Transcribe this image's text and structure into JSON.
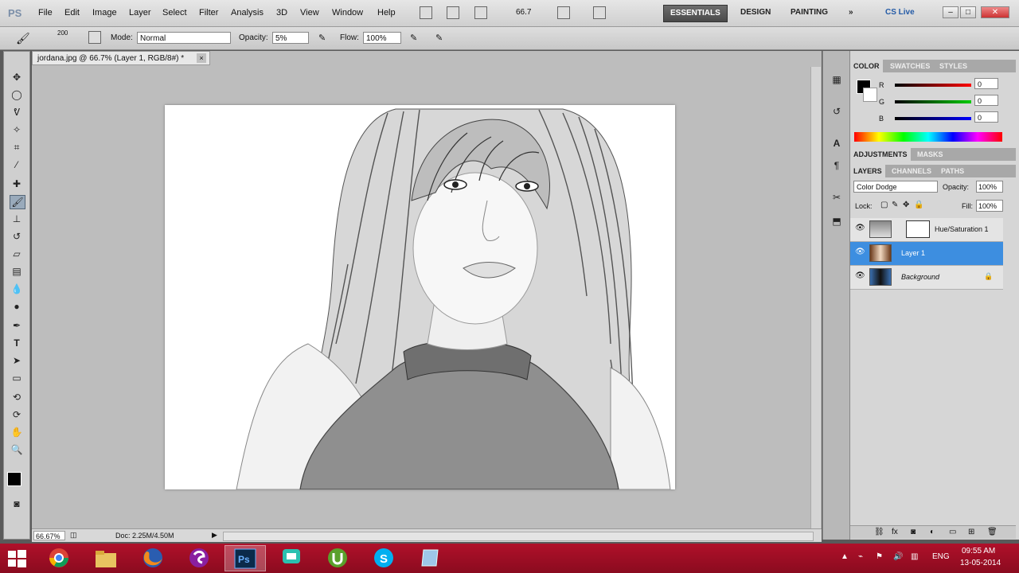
{
  "app": {
    "logo": "PS"
  },
  "menu": {
    "items": [
      "File",
      "Edit",
      "Image",
      "Layer",
      "Select",
      "Filter",
      "Analysis",
      "3D",
      "View",
      "Window",
      "Help"
    ]
  },
  "appbar": {
    "zoom": "66.7"
  },
  "workspaces": {
    "items": [
      "ESSENTIALS",
      "DESIGN",
      "PAINTING"
    ],
    "more": "»",
    "cslive": "CS Live"
  },
  "options": {
    "brush_size": "200",
    "mode_label": "Mode:",
    "mode_value": "Normal",
    "opacity_label": "Opacity:",
    "opacity_value": "5%",
    "flow_label": "Flow:",
    "flow_value": "100%"
  },
  "document": {
    "tab_title": "jordana.jpg @ 66.7% (Layer 1, RGB/8#) *",
    "tab_close": "×",
    "zoom_status": "66.67%",
    "doc_info": "Doc: 2.25M/4.50M"
  },
  "color_panel": {
    "tabs": [
      "COLOR",
      "SWATCHES",
      "STYLES"
    ],
    "channels": [
      {
        "label": "R",
        "value": "0"
      },
      {
        "label": "G",
        "value": "0"
      },
      {
        "label": "B",
        "value": "0"
      }
    ]
  },
  "adjust_panel": {
    "tabs": [
      "ADJUSTMENTS",
      "MASKS"
    ]
  },
  "layers_panel": {
    "tabs": [
      "LAYERS",
      "CHANNELS",
      "PATHS"
    ],
    "blend_mode": "Color Dodge",
    "opacity_label": "Opacity:",
    "opacity_value": "100%",
    "lock_label": "Lock:",
    "fill_label": "Fill:",
    "fill_value": "100%",
    "layers": [
      {
        "name": "Hue/Saturation 1"
      },
      {
        "name": "Layer 1"
      },
      {
        "name": "Background"
      }
    ]
  },
  "taskbar": {
    "apps": [
      "chrome",
      "explorer",
      "firefox",
      "superantispyware",
      "photoshop",
      "hangouts",
      "utorrent",
      "skype",
      "notes"
    ],
    "lang": "ENG",
    "time": "09:55 AM",
    "date": "13-05-2014"
  },
  "colors": {
    "selection": "#3d8ee0",
    "taskbar": "#a60e25",
    "canvas_bg": "#bdbdbd"
  }
}
